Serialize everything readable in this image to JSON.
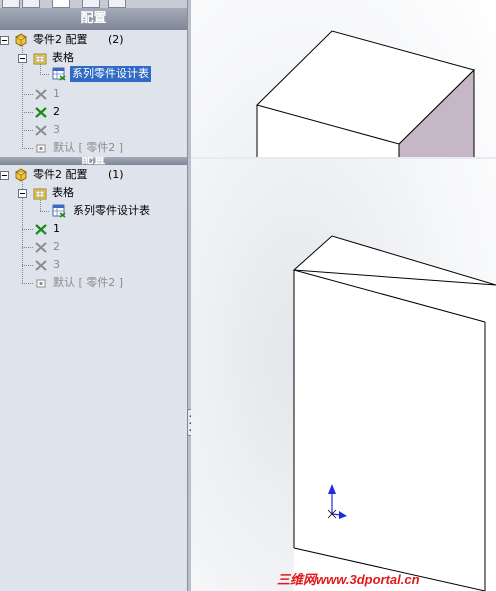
{
  "panel_top": {
    "title": "配置",
    "root": {
      "name": "零件2 配置",
      "count": "(2)"
    },
    "table": {
      "label": "表格"
    },
    "design_table": {
      "label": "系列零件设计表"
    },
    "configs": [
      {
        "label": "1",
        "active": false
      },
      {
        "label": "2",
        "active": true
      },
      {
        "label": "3",
        "active": false
      },
      {
        "label": "默认 [ 零件2 ]",
        "active": false
      }
    ]
  },
  "panel_bottom": {
    "title": "配置",
    "root": {
      "name": "零件2 配置",
      "count": "(1)"
    },
    "table": {
      "label": "表格"
    },
    "design_table": {
      "label": "系列零件设计表"
    },
    "configs": [
      {
        "label": "1",
        "active": true
      },
      {
        "label": "2",
        "active": false
      },
      {
        "label": "3",
        "active": false
      },
      {
        "label": "默认 [ 零件2 ]",
        "active": false
      }
    ]
  },
  "watermark": "三维网www.3dportal.cn",
  "colors": {
    "panel_bg": "#dfe3eb",
    "header": "#8c93a2",
    "selection": "#316ac5",
    "active_config": "#1a8a1a",
    "inactive_config": "#8c8c8c",
    "part_side_face": "#c6b7c6",
    "watermark": "#e01b1b",
    "axis": "#1a2ee0"
  }
}
